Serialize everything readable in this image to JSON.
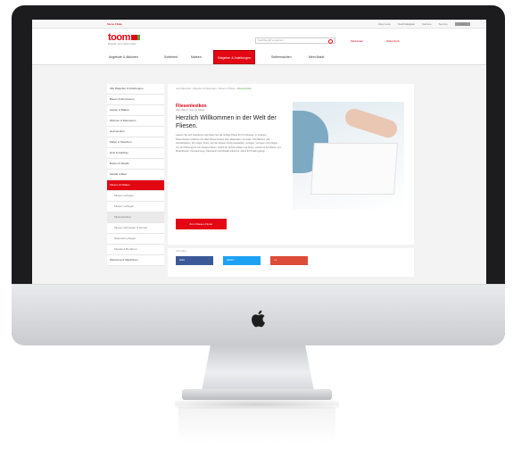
{
  "topbar": {
    "left": "Meine Filiale",
    "links": [
      "Über toom",
      "Nachhaltigkeit",
      "Karriere",
      "Service"
    ],
    "login": "Login"
  },
  "header": {
    "logo": "toom",
    "tagline": "Respekt, wer's selber macht.",
    "search_placeholder": "Suchbegriff eingeben",
    "links": [
      "Merkzettel",
      "Warenkorb"
    ]
  },
  "nav": {
    "items": [
      "Angebote & Aktionen",
      "Sortiment",
      "Marken",
      "Ratgeber & Anleitungen",
      "Selbermachen",
      "Mein Markt"
    ],
    "active_index": 3
  },
  "sidebar": {
    "items": [
      {
        "label": "Alle Ratgeber & Anleitungen",
        "type": "top"
      },
      {
        "label": "Bauen & Renovieren",
        "type": "top"
      },
      {
        "label": "Garten & Balkon",
        "type": "top"
      },
      {
        "label": "Wohnen & Dekorieren",
        "type": "top"
      },
      {
        "label": "Heimwerken",
        "type": "top"
      },
      {
        "label": "Malen & Streichen",
        "type": "top"
      },
      {
        "label": "Holz & Holzbau",
        "type": "top"
      },
      {
        "label": "Boden & Wände",
        "type": "top"
      },
      {
        "label": "Sanitär & Bad",
        "type": "top"
      },
      {
        "label": "Fliesen & Platten",
        "type": "active"
      },
      {
        "label": "Fliesen verlegen",
        "type": "sub"
      },
      {
        "label": "Fliesen verfugen",
        "type": "sub"
      },
      {
        "label": "Fliesenlexikon",
        "type": "selected"
      },
      {
        "label": "Fliesen schneiden & bohren",
        "type": "sub"
      },
      {
        "label": "Naturstein pflegen",
        "type": "sub"
      },
      {
        "label": "Mosaik & Bordüren",
        "type": "sub"
      },
      {
        "label": "Werkzeug & Maschinen",
        "type": "top"
      }
    ]
  },
  "main": {
    "breadcrumb": [
      "toom Baumarkt",
      "Ratgeber & Anleitungen",
      "Fliesen & Platten"
    ],
    "breadcrumb_current": "Fliesenlexikon",
    "kicker": "Fliesenlexikon",
    "subkicker": "Alles Wissen rund um Fliesen",
    "headline": "Herzlich Willkommen in der Welt der Fliesen.",
    "body": "Lassen Sie sich inspirieren und finden Sie die richtige Fliese für Ihr Zuhause. In unserem Fliesenlexikon erfahren Sie alles Wissenswerte über Materialien, Formate, Oberflächen und Abriebklassen. Wir zeigen Ihnen, wie Sie Fliesen richtig auswählen, verlegen, verfugen und pflegen – von der Planung bis zum fertigen Raum. Schritt für Schritt erklären wir Ihnen, worauf es bei Wand- und Bodenfliesen, Feinsteinzeug, Naturstein und Mosaik ankommt, damit Ihr Projekt gelingt.",
    "cta": "Zum Fliesen-Finder"
  },
  "share": {
    "label": "Jetzt teilen:",
    "buttons": [
      {
        "label": "teilen",
        "color": "#3b5998"
      },
      {
        "label": "twittern",
        "color": "#1da1f2"
      },
      {
        "label": "+1",
        "color": "#dd4b39"
      }
    ]
  },
  "colors": {
    "brand": "#e30613",
    "accent_green": "#4fa83d"
  }
}
